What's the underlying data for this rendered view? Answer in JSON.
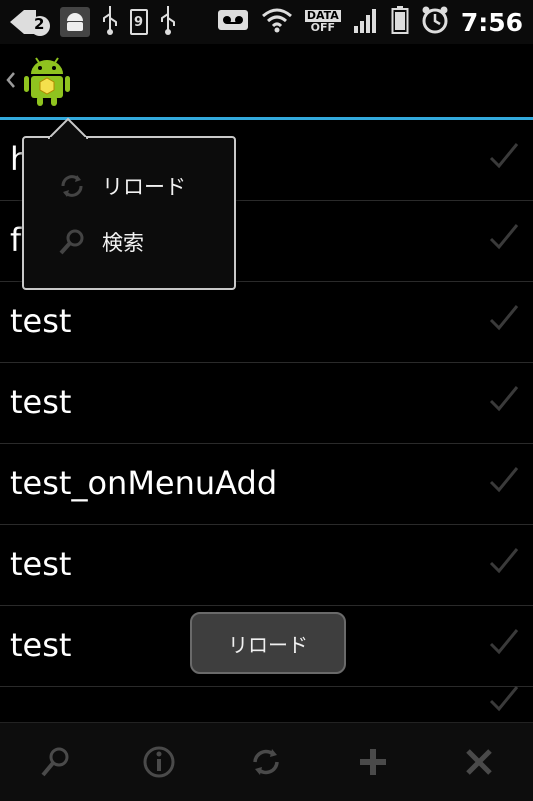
{
  "status_bar": {
    "notification_count": "2",
    "sd_badge": "9",
    "data_label_top": "DATA",
    "data_label_bottom": "OFF",
    "time": "7:56"
  },
  "action_bar": {
    "icons": [
      "up-caret-icon",
      "android-app-icon"
    ],
    "accent_color": "#33aadd"
  },
  "popup_menu": {
    "items": [
      {
        "label": "リロード",
        "icon": "reload-icon"
      },
      {
        "label": "検索",
        "icon": "search-icon"
      }
    ]
  },
  "list": {
    "items": [
      {
        "label": "h"
      },
      {
        "label": "f"
      },
      {
        "label": "test"
      },
      {
        "label": "test"
      },
      {
        "label": "test_onMenuAdd"
      },
      {
        "label": "test"
      },
      {
        "label": "test"
      }
    ]
  },
  "toast": {
    "text": "リロード"
  },
  "toolbar": {
    "buttons": [
      "search-icon",
      "info-icon",
      "reload-icon",
      "add-icon",
      "close-icon"
    ]
  }
}
